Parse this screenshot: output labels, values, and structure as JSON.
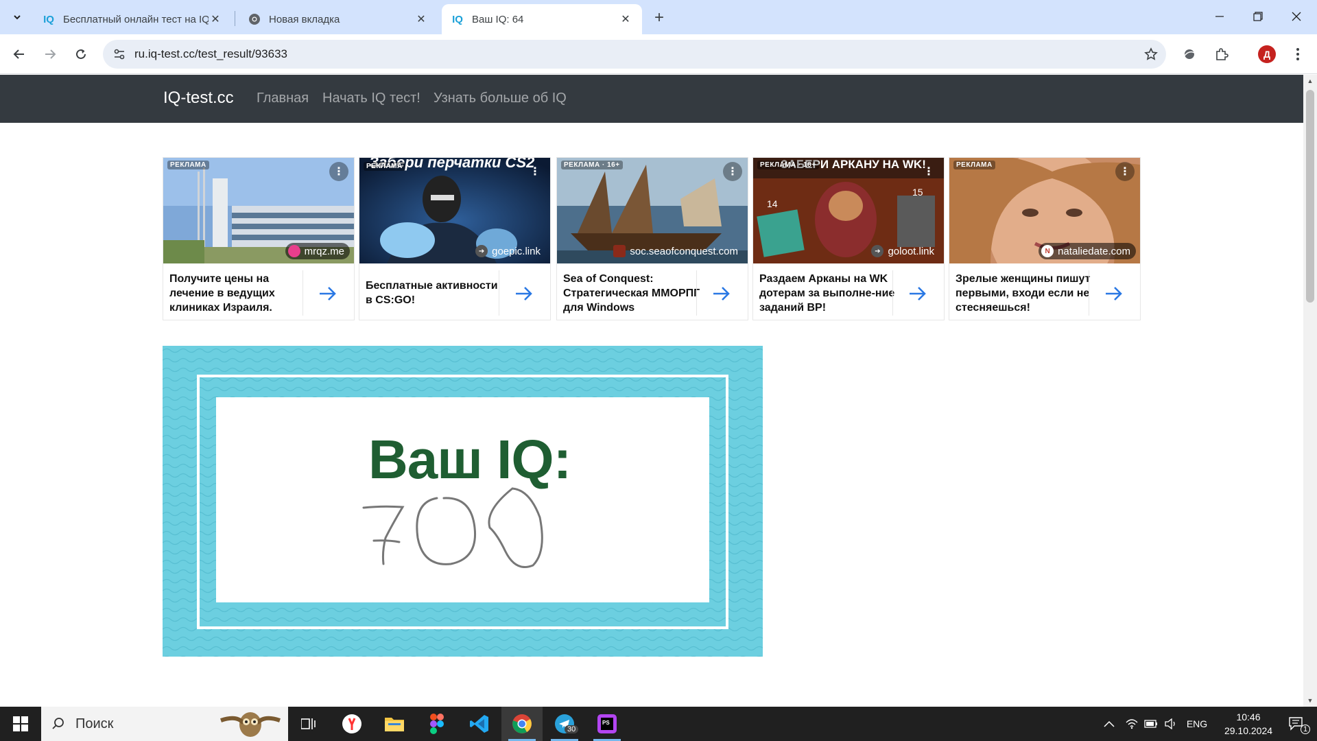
{
  "browser": {
    "tabs": [
      {
        "title": "Бесплатный онлайн тест на IQ",
        "favicon": "IQ"
      },
      {
        "title": "Новая вкладка",
        "favicon": "chrome"
      },
      {
        "title": "Ваш IQ: 64",
        "favicon": "IQ",
        "active": true
      }
    ],
    "url": "ru.iq-test.cc/test_result/93633",
    "profile_initial": "Д"
  },
  "site": {
    "brand": "IQ-test.cc",
    "nav": [
      "Главная",
      "Начать IQ тест!",
      "Узнать больше об IQ"
    ]
  },
  "ads": [
    {
      "badge": "РЕКЛАМА",
      "domain": "mrqz.me",
      "text": "Получите цены на лечение в ведущих клиниках Израиля.",
      "dot_color": "#e83e8c"
    },
    {
      "badge": "РЕКЛАМА",
      "domain": "goepic.link",
      "text": "Бесплатные активности в CS:GO!",
      "banner": "Забери перчатки CS2",
      "dot_color": "#444"
    },
    {
      "badge": "РЕКЛАМА · 16+",
      "domain": "soc.seaofconquest.com",
      "text": "Sea of Conquest: Стратегическая ММОРПГ для Windows",
      "dot_color": "#8b2a1a"
    },
    {
      "badge": "РЕКЛАМА · 18+",
      "domain": "goloot.link",
      "text": "Раздаем Арканы на WK дотерам за выполне-ние заданий ВР!",
      "banner": "ЗАБЕРИ АРКАНУ НА WK!",
      "dot_color": "#444"
    },
    {
      "badge": "РЕКЛАМА",
      "domain": "nataliedate.com",
      "text": "Зрелые женщины пишут первыми, входи если не стесняешься!",
      "dot_color": "#c0392b"
    }
  ],
  "result": {
    "title": "Ваш IQ:",
    "handwritten_value": "700"
  },
  "taskbar": {
    "search_placeholder": "Поиск",
    "telegram_badge": "30",
    "language": "ENG",
    "time": "10:46",
    "date": "29.10.2024",
    "notifications": "1"
  }
}
